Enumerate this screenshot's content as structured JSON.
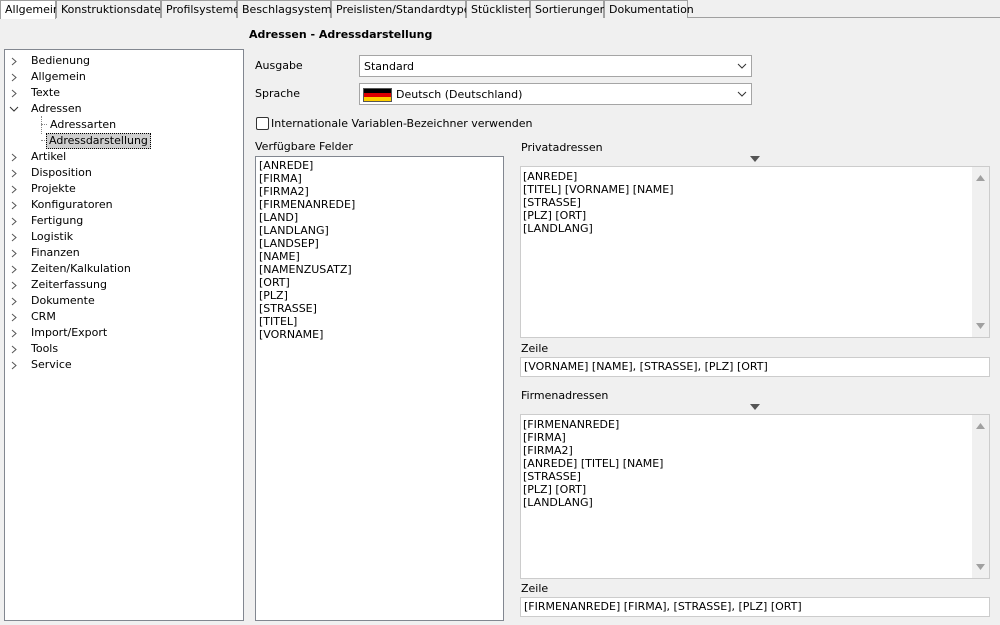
{
  "tabs": [
    "Allgemein",
    "Konstruktionsdaten",
    "Profilsysteme",
    "Beschlagsysteme",
    "Preislisten/Standardtypen",
    "Stücklisten",
    "Sortierungen",
    "Dokumentation"
  ],
  "tree": {
    "items": [
      "Bedienung",
      "Allgemein",
      "Texte",
      "Adressen",
      "Adressarten",
      "Adressdarstellung",
      "Artikel",
      "Disposition",
      "Projekte",
      "Konfiguratoren",
      "Fertigung",
      "Logistik",
      "Finanzen",
      "Zeiten/Kalkulation",
      "Zeiterfassung",
      "Dokumente",
      "CRM",
      "Import/Export",
      "Tools",
      "Service"
    ],
    "selected": "Adressdarstellung"
  },
  "section_title": "Adressen - Adressdarstellung",
  "ausgabe": {
    "label": "Ausgabe",
    "value": "Standard"
  },
  "sprache": {
    "label": "Sprache",
    "value": "Deutsch (Deutschland)"
  },
  "intl_checkbox": {
    "label": "Internationale Variablen-Bezeichner verwenden",
    "checked": false
  },
  "verfuegbare": {
    "label": "Verfügbare Felder",
    "items": [
      "[ANREDE]",
      "[FIRMA]",
      "[FIRMA2]",
      "[FIRMENANREDE]",
      "[LAND]",
      "[LANDLANG]",
      "[LANDSEP]",
      "[NAME]",
      "[NAMENZUSATZ]",
      "[ORT]",
      "[PLZ]",
      "[STRASSE]",
      "[TITEL]",
      "[VORNAME]"
    ]
  },
  "privat": {
    "label": "Privatadressen",
    "lines": [
      "[ANREDE]",
      "[TITEL] [VORNAME] [NAME]",
      "[STRASSE]",
      "[PLZ] [ORT]",
      "[LANDLANG]"
    ],
    "zeile_label": "Zeile",
    "zeile": "[VORNAME] [NAME], [STRASSE], [PLZ] [ORT]"
  },
  "firma": {
    "label": "Firmenadressen",
    "lines": [
      "[FIRMENANREDE]",
      "[FIRMA]",
      "[FIRMA2]",
      "[ANREDE] [TITEL] [NAME]",
      "[STRASSE]",
      "[PLZ] [ORT]",
      "[LANDLANG]"
    ],
    "zeile_label": "Zeile",
    "zeile": "[FIRMENANREDE] [FIRMA], [STRASSE], [PLZ] [ORT]"
  },
  "colors": {
    "flag_black": "#000000",
    "flag_red": "#dd0000",
    "flag_gold": "#ffce00",
    "selection": "#cfcfcf"
  }
}
